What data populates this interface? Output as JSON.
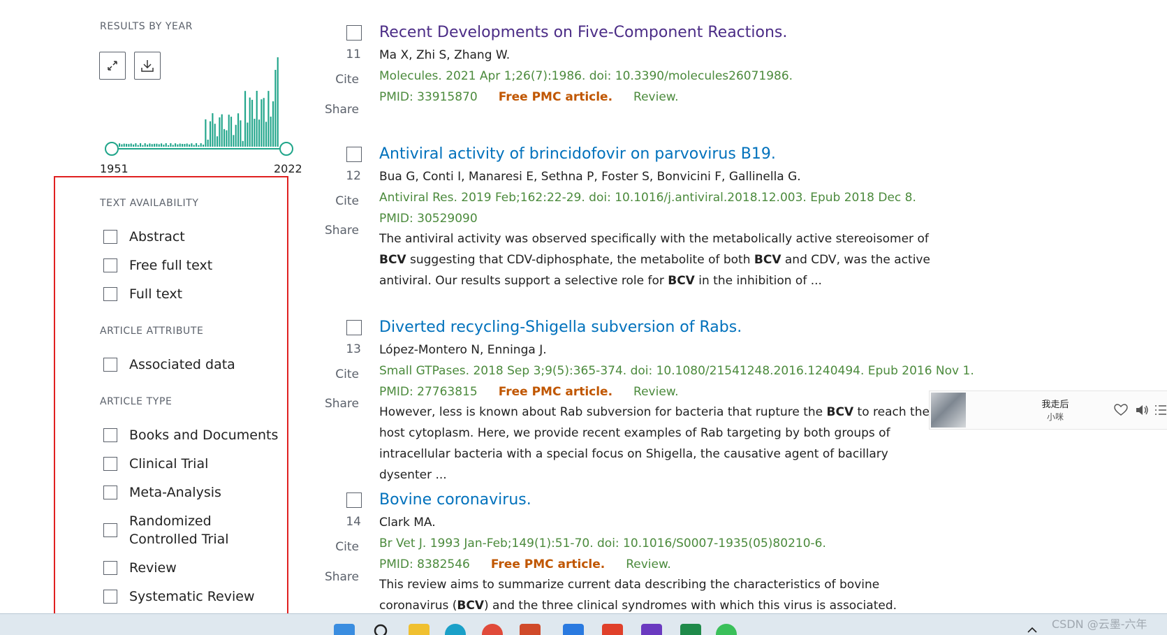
{
  "sidebar": {
    "results_by_year": {
      "heading": "RESULTS BY YEAR",
      "expand_icon": "expand-icon",
      "download_icon": "download-icon",
      "year_start": "1951",
      "year_end": "2022",
      "accent_color": "#20a58a"
    },
    "text_availability": {
      "heading": "TEXT AVAILABILITY",
      "items": [
        "Abstract",
        "Free full text",
        "Full text"
      ]
    },
    "article_attribute": {
      "heading": "ARTICLE ATTRIBUTE",
      "items": [
        "Associated data"
      ]
    },
    "article_type": {
      "heading": "ARTICLE TYPE",
      "items": [
        "Books and Documents",
        "Clinical Trial",
        "Meta-Analysis",
        "Randomized Controlled Trial",
        "Review",
        "Systematic Review"
      ]
    }
  },
  "results": [
    {
      "number": "11",
      "title": "Recent Developments on Five-Component Reactions.",
      "authors": "Ma X, Zhi S, Zhang W.",
      "citation": "Molecules. 2021 Apr 1;26(7):1986. doi: 10.3390/molecules26071986.",
      "pmid": "PMID: 33915870",
      "free_pmc": "Free PMC article.",
      "type": "Review."
    },
    {
      "number": "12",
      "title": "Antiviral activity of brincidofovir on parvovirus B19.",
      "authors": "Bua G, Conti I, Manaresi E, Sethna P, Foster S, Bonvicini F, Gallinella G.",
      "citation": "Antiviral Res. 2019 Feb;162:22-29. doi: 10.1016/j.antiviral.2018.12.003. Epub 2018 Dec 8.",
      "pmid": "PMID: 30529090",
      "snippet": [
        {
          "t": "The antiviral activity was observed specifically with the metabolically active stereoisomer of "
        },
        {
          "t": "BCV",
          "b": true
        },
        {
          "t": " suggesting that CDV-diphosphate, the metabolite of both "
        },
        {
          "t": "BCV",
          "b": true
        },
        {
          "t": " and CDV, was the active antiviral. Our results support a selective role for "
        },
        {
          "t": "BCV",
          "b": true
        },
        {
          "t": " in the inhibition of ..."
        }
      ]
    },
    {
      "number": "13",
      "title": "Diverted recycling-Shigella subversion of Rabs.",
      "authors": "López-Montero N, Enninga J.",
      "citation": "Small GTPases. 2018 Sep 3;9(5):365-374. doi: 10.1080/21541248.2016.1240494. Epub 2016 Nov 1.",
      "pmid": "PMID: 27763815",
      "free_pmc": "Free PMC article.",
      "type": "Review.",
      "snippet": [
        {
          "t": "However, less is known about Rab subversion for bacteria that rupture the "
        },
        {
          "t": "BCV",
          "b": true
        },
        {
          "t": " to reach the host cytoplasm. Here, we provide recent examples of Rab targeting by both groups of intracellular bacteria with a special focus on Shigella, the causative agent of bacillary dysenter ..."
        }
      ]
    },
    {
      "number": "14",
      "title": "Bovine coronavirus.",
      "authors": "Clark MA.",
      "citation": "Br Vet J. 1993 Jan-Feb;149(1):51-70. doi: 10.1016/S0007-1935(05)80210-6.",
      "pmid": "PMID: 8382546",
      "free_pmc": "Free PMC article.",
      "type": "Review.",
      "snippet": [
        {
          "t": "This review aims to summarize current data describing the characteristics of bovine coronavirus ("
        },
        {
          "t": "BCV",
          "b": true
        },
        {
          "t": ") and the three clinical syndromes with which this virus is associated. ...The clinical and epidemiological"
        }
      ]
    }
  ],
  "actions": {
    "cite": "Cite",
    "share": "Share"
  },
  "player": {
    "song": "我走后",
    "artist": "小咪"
  },
  "watermark": "CSDN @云墨-六年"
}
